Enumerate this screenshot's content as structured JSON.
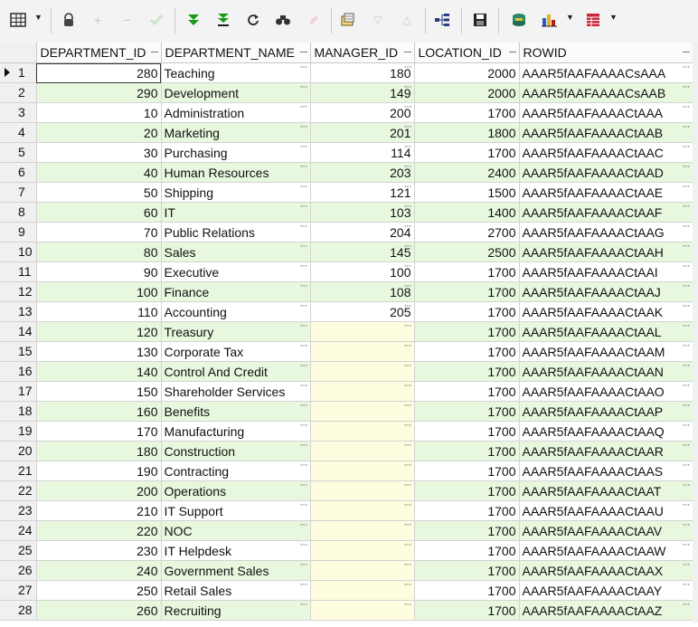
{
  "toolbar": {
    "icons": [
      "grid-menu-icon",
      "lock-icon",
      "add-record-icon",
      "remove-record-icon",
      "post-edit-icon",
      "fetch-next-icon",
      "fetch-all-icon",
      "refresh-icon",
      "find-icon",
      "clear-icon",
      "query-by-example-icon",
      "sort-asc-icon",
      "sort-desc-icon",
      "explain-plan-icon",
      "save-icon",
      "export-icon",
      "chart-icon",
      "grid-view-icon"
    ]
  },
  "grid": {
    "columns": [
      "DEPARTMENT_ID",
      "DEPARTMENT_NAME",
      "MANAGER_ID",
      "LOCATION_ID",
      "ROWID"
    ],
    "rows": [
      {
        "n": "1",
        "id": "280",
        "name": "Teaching",
        "mgr": "180",
        "loc": "2000",
        "rowid": "AAAR5fAAFAAAACsAAA"
      },
      {
        "n": "2",
        "id": "290",
        "name": "Development",
        "mgr": "149",
        "loc": "2000",
        "rowid": "AAAR5fAAFAAAACsAAB"
      },
      {
        "n": "3",
        "id": "10",
        "name": "Administration",
        "mgr": "200",
        "loc": "1700",
        "rowid": "AAAR5fAAFAAAACtAAA"
      },
      {
        "n": "4",
        "id": "20",
        "name": "Marketing",
        "mgr": "201",
        "loc": "1800",
        "rowid": "AAAR5fAAFAAAACtAAB"
      },
      {
        "n": "5",
        "id": "30",
        "name": "Purchasing",
        "mgr": "114",
        "loc": "1700",
        "rowid": "AAAR5fAAFAAAACtAAC"
      },
      {
        "n": "6",
        "id": "40",
        "name": "Human Resources",
        "mgr": "203",
        "loc": "2400",
        "rowid": "AAAR5fAAFAAAACtAAD"
      },
      {
        "n": "7",
        "id": "50",
        "name": "Shipping",
        "mgr": "121",
        "loc": "1500",
        "rowid": "AAAR5fAAFAAAACtAAE"
      },
      {
        "n": "8",
        "id": "60",
        "name": "IT",
        "mgr": "103",
        "loc": "1400",
        "rowid": "AAAR5fAAFAAAACtAAF"
      },
      {
        "n": "9",
        "id": "70",
        "name": "Public Relations",
        "mgr": "204",
        "loc": "2700",
        "rowid": "AAAR5fAAFAAAACtAAG"
      },
      {
        "n": "10",
        "id": "80",
        "name": "Sales",
        "mgr": "145",
        "loc": "2500",
        "rowid": "AAAR5fAAFAAAACtAAH"
      },
      {
        "n": "11",
        "id": "90",
        "name": "Executive",
        "mgr": "100",
        "loc": "1700",
        "rowid": "AAAR5fAAFAAAACtAAI"
      },
      {
        "n": "12",
        "id": "100",
        "name": "Finance",
        "mgr": "108",
        "loc": "1700",
        "rowid": "AAAR5fAAFAAAACtAAJ"
      },
      {
        "n": "13",
        "id": "110",
        "name": "Accounting",
        "mgr": "205",
        "loc": "1700",
        "rowid": "AAAR5fAAFAAAACtAAK"
      },
      {
        "n": "14",
        "id": "120",
        "name": "Treasury",
        "mgr": "",
        "loc": "1700",
        "rowid": "AAAR5fAAFAAAACtAAL"
      },
      {
        "n": "15",
        "id": "130",
        "name": "Corporate Tax",
        "mgr": "",
        "loc": "1700",
        "rowid": "AAAR5fAAFAAAACtAAM"
      },
      {
        "n": "16",
        "id": "140",
        "name": "Control And Credit",
        "mgr": "",
        "loc": "1700",
        "rowid": "AAAR5fAAFAAAACtAAN"
      },
      {
        "n": "17",
        "id": "150",
        "name": "Shareholder Services",
        "mgr": "",
        "loc": "1700",
        "rowid": "AAAR5fAAFAAAACtAAO"
      },
      {
        "n": "18",
        "id": "160",
        "name": "Benefits",
        "mgr": "",
        "loc": "1700",
        "rowid": "AAAR5fAAFAAAACtAAP"
      },
      {
        "n": "19",
        "id": "170",
        "name": "Manufacturing",
        "mgr": "",
        "loc": "1700",
        "rowid": "AAAR5fAAFAAAACtAAQ"
      },
      {
        "n": "20",
        "id": "180",
        "name": "Construction",
        "mgr": "",
        "loc": "1700",
        "rowid": "AAAR5fAAFAAAACtAAR"
      },
      {
        "n": "21",
        "id": "190",
        "name": "Contracting",
        "mgr": "",
        "loc": "1700",
        "rowid": "AAAR5fAAFAAAACtAAS"
      },
      {
        "n": "22",
        "id": "200",
        "name": "Operations",
        "mgr": "",
        "loc": "1700",
        "rowid": "AAAR5fAAFAAAACtAAT"
      },
      {
        "n": "23",
        "id": "210",
        "name": "IT Support",
        "mgr": "",
        "loc": "1700",
        "rowid": "AAAR5fAAFAAAACtAAU"
      },
      {
        "n": "24",
        "id": "220",
        "name": "NOC",
        "mgr": "",
        "loc": "1700",
        "rowid": "AAAR5fAAFAAAACtAAV"
      },
      {
        "n": "25",
        "id": "230",
        "name": "IT Helpdesk",
        "mgr": "",
        "loc": "1700",
        "rowid": "AAAR5fAAFAAAACtAAW"
      },
      {
        "n": "26",
        "id": "240",
        "name": "Government Sales",
        "mgr": "",
        "loc": "1700",
        "rowid": "AAAR5fAAFAAAACtAAX"
      },
      {
        "n": "27",
        "id": "250",
        "name": "Retail Sales",
        "mgr": "",
        "loc": "1700",
        "rowid": "AAAR5fAAFAAAACtAAY"
      },
      {
        "n": "28",
        "id": "260",
        "name": "Recruiting",
        "mgr": "",
        "loc": "1700",
        "rowid": "AAAR5fAAFAAAACtAAZ"
      }
    ]
  },
  "colors": {
    "even_row": "#e8f8df",
    "odd_row": "#ffffff",
    "null_cell": "#fffde0",
    "green_arrow": "#1a9a1a"
  }
}
